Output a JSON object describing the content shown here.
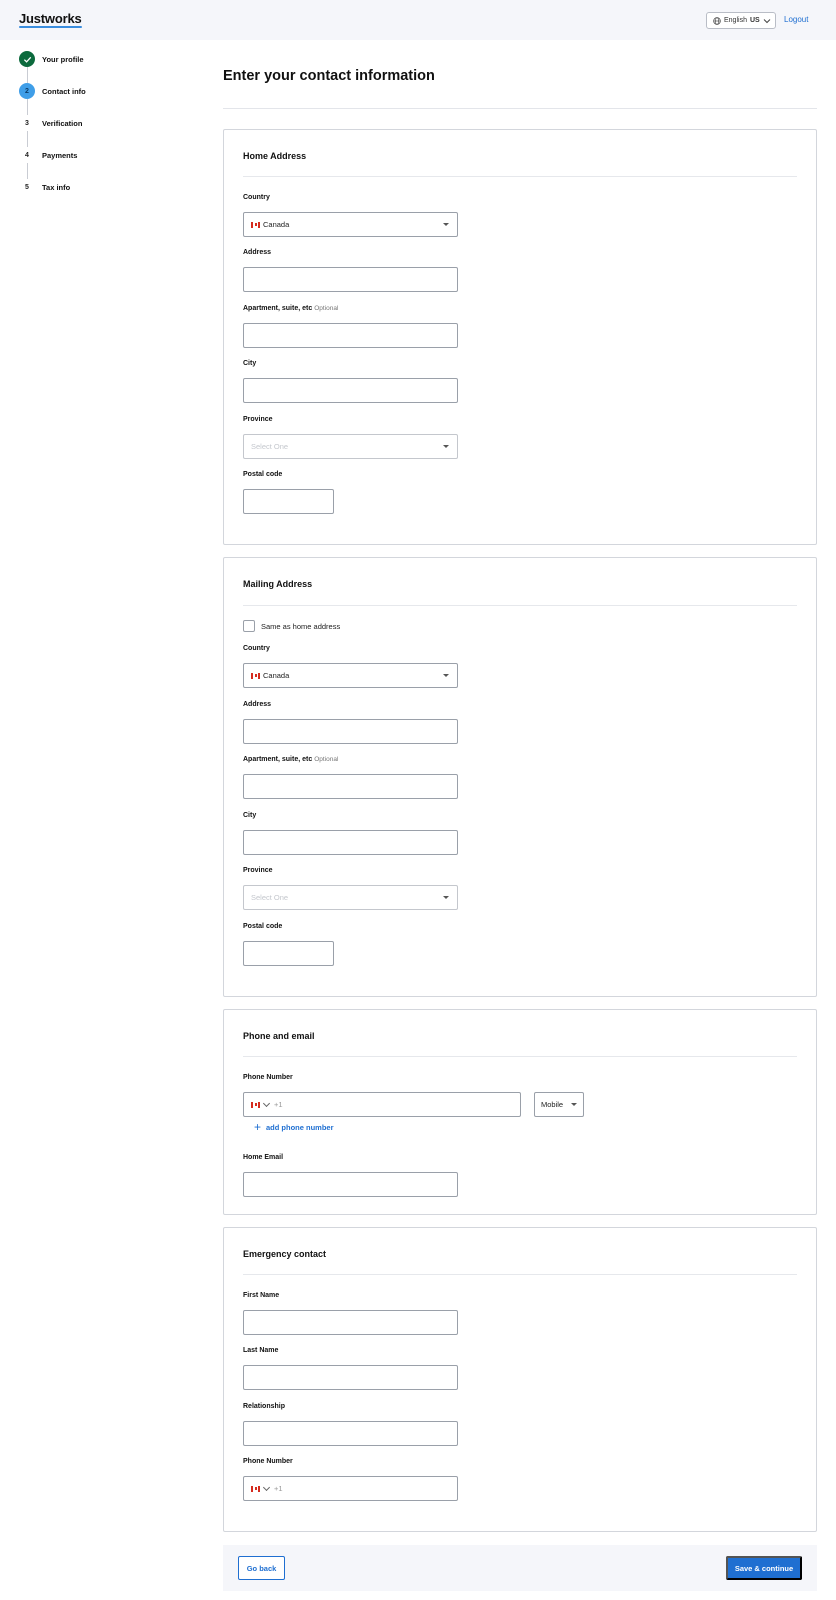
{
  "header": {
    "logo": "Justworks",
    "language_prefix": "English",
    "language_region": "US",
    "logout_label": "Logout"
  },
  "steps": [
    {
      "number": "",
      "label": "Your profile",
      "state": "done"
    },
    {
      "number": "2",
      "label": "Contact info",
      "state": "current"
    },
    {
      "number": "3",
      "label": "Verification",
      "state": "upcoming"
    },
    {
      "number": "4",
      "label": "Payments",
      "state": "upcoming"
    },
    {
      "number": "5",
      "label": "Tax info",
      "state": "upcoming"
    }
  ],
  "page_title": "Enter your contact information",
  "home": {
    "title": "Home Address",
    "country_label": "Country",
    "country_value": "Canada",
    "address_label": "Address",
    "apt_label": "Apartment, suite, etc",
    "apt_optional": "Optional",
    "city_label": "City",
    "province_label": "Province",
    "province_placeholder": "Select One",
    "postal_label": "Postal code"
  },
  "mailing": {
    "title": "Mailing Address",
    "same_as_label": "Same as home address",
    "country_label": "Country",
    "country_value": "Canada",
    "address_label": "Address",
    "apt_label": "Apartment, suite, etc",
    "apt_optional": "Optional",
    "city_label": "City",
    "province_label": "Province",
    "province_placeholder": "Select One",
    "postal_label": "Postal code"
  },
  "phone_email": {
    "title": "Phone and email",
    "phone_label": "Phone Number",
    "phone_prefix": "+1",
    "phone_type": "Mobile",
    "add_phone_label": "add phone number",
    "email_label": "Home Email"
  },
  "emergency": {
    "title": "Emergency contact",
    "first_name_label": "First Name",
    "last_name_label": "Last Name",
    "relationship_label": "Relationship",
    "phone_label": "Phone Number",
    "phone_prefix": "+1"
  },
  "footer": {
    "back_label": "Go back",
    "save_label": "Save & continue"
  },
  "colors": {
    "accent": "#1f6fd1",
    "step_done": "#0c6a3d",
    "step_current": "#3f9ee8"
  }
}
